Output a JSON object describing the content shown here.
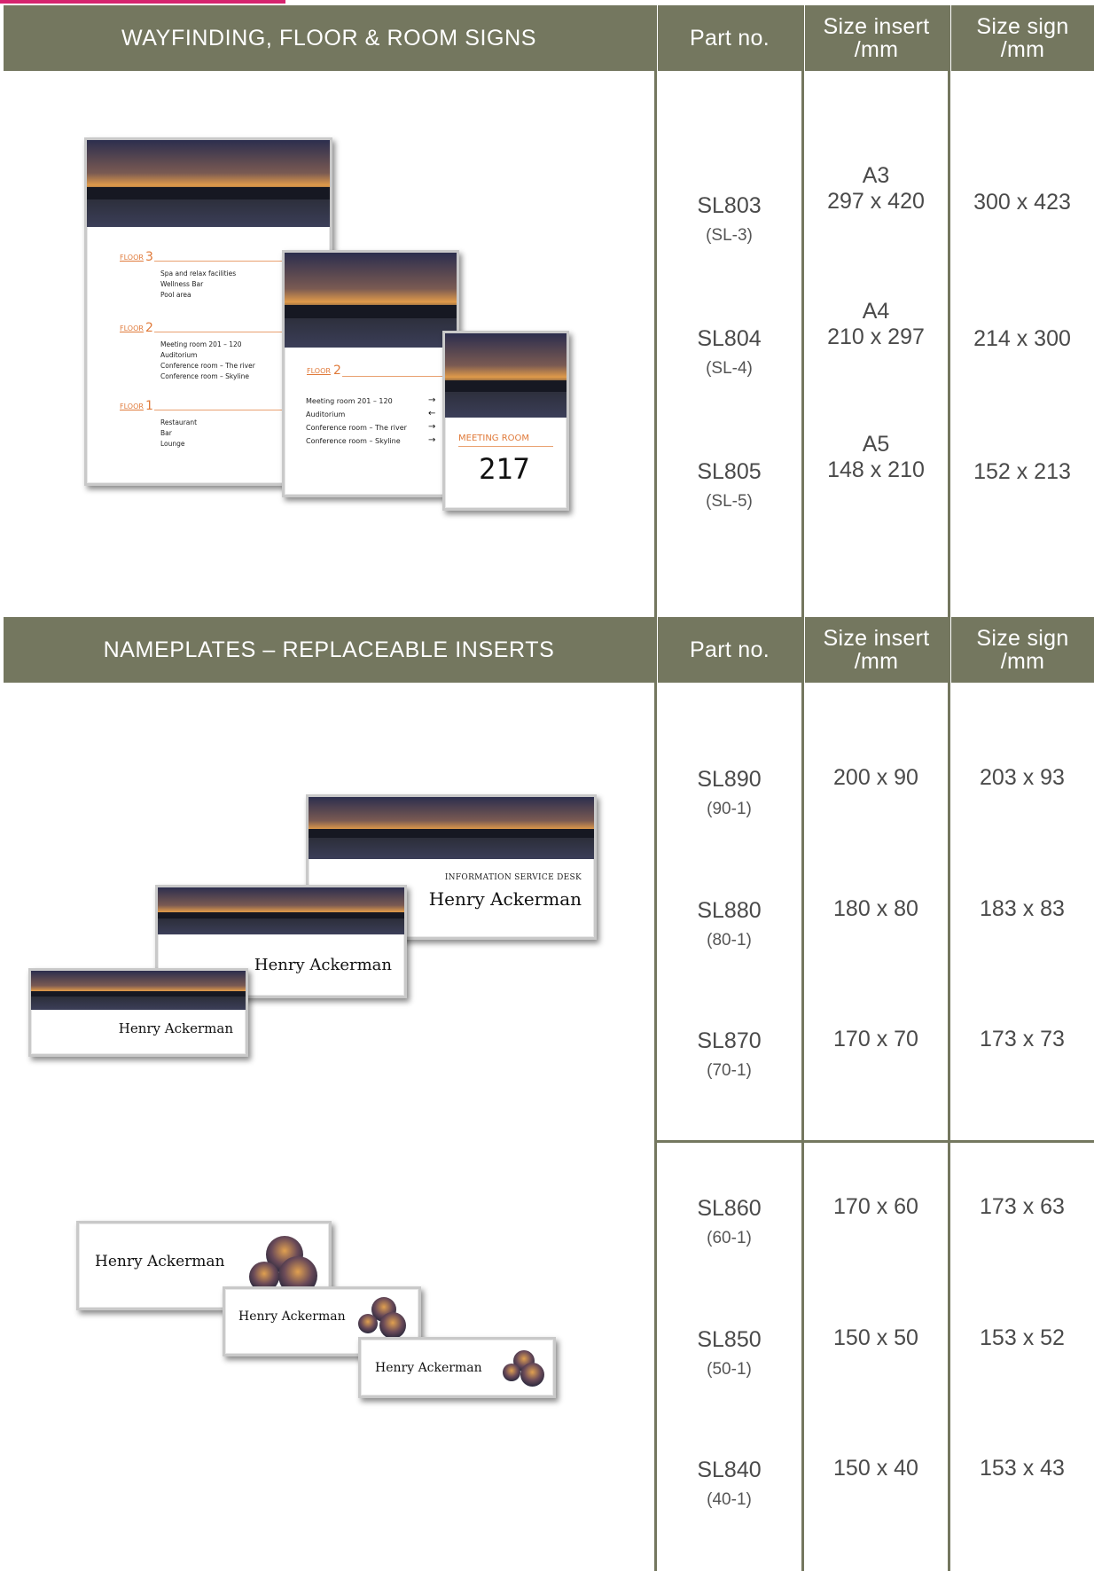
{
  "section1": {
    "title": "WAYFINDING, FLOOR & ROOM SIGNS",
    "col_part": "Part no.",
    "col_insert": "Size insert /mm",
    "col_sign": "Size sign /mm",
    "rows": [
      {
        "part": "SL803",
        "old": "(SL-3)",
        "format": "A3",
        "insert": "297 x 420",
        "sign": "300 x 423"
      },
      {
        "part": "SL804",
        "old": "(SL-4)",
        "format": "A4",
        "insert": "210 x 297",
        "sign": "214 x 300"
      },
      {
        "part": "SL805",
        "old": "(SL-5)",
        "format": "A5",
        "insert": "148 x 210",
        "sign": "152 x 213"
      }
    ],
    "image": {
      "big": {
        "floors": [
          {
            "label": "FLOOR",
            "num": "3",
            "items": [
              "Spa and relax facilities",
              "Wellness Bar",
              "Pool area"
            ]
          },
          {
            "label": "FLOOR",
            "num": "2",
            "items": [
              "Meeting room 201 – 120",
              "Auditorium",
              "Conference room – The river",
              "Conference room – Skyline"
            ]
          },
          {
            "label": "FLOOR",
            "num": "1",
            "items": [
              "Restaurant",
              "Bar",
              "Lounge"
            ]
          }
        ]
      },
      "mid": {
        "label": "FLOOR",
        "num": "2",
        "items": [
          "Meeting room 201 – 120",
          "Auditorium",
          "Conference room – The river",
          "Conference room – Skyline"
        ],
        "arrows": [
          "→",
          "←",
          "→",
          "→"
        ]
      },
      "small": {
        "label": "MEETING ROOM",
        "num": "217"
      }
    }
  },
  "section2": {
    "title": "NAMEPLATES – REPLACEABLE INSERTS",
    "col_part": "Part no.",
    "col_insert": "Size insert /mm",
    "col_sign": "Size sign /mm",
    "rows": [
      {
        "part": "SL890",
        "old": "(90-1)",
        "insert": "200 x 90",
        "sign": "203 x 93"
      },
      {
        "part": "SL880",
        "old": "(80-1)",
        "insert": "180 x 80",
        "sign": "183 x 83"
      },
      {
        "part": "SL870",
        "old": "(70-1)",
        "insert": "170 x 70",
        "sign": "173 x 73"
      },
      {
        "part": "SL860",
        "old": "(60-1)",
        "insert": "170 x 60",
        "sign": "173 x 63"
      },
      {
        "part": "SL850",
        "old": "(50-1)",
        "insert": "150 x 50",
        "sign": "153 x 52"
      },
      {
        "part": "SL840",
        "old": "(40-1)",
        "insert": "150 x 40",
        "sign": "153 x 43"
      }
    ],
    "image": {
      "info": "INFORMATION SERVICE DESK",
      "name": "Henry Ackerman"
    }
  }
}
